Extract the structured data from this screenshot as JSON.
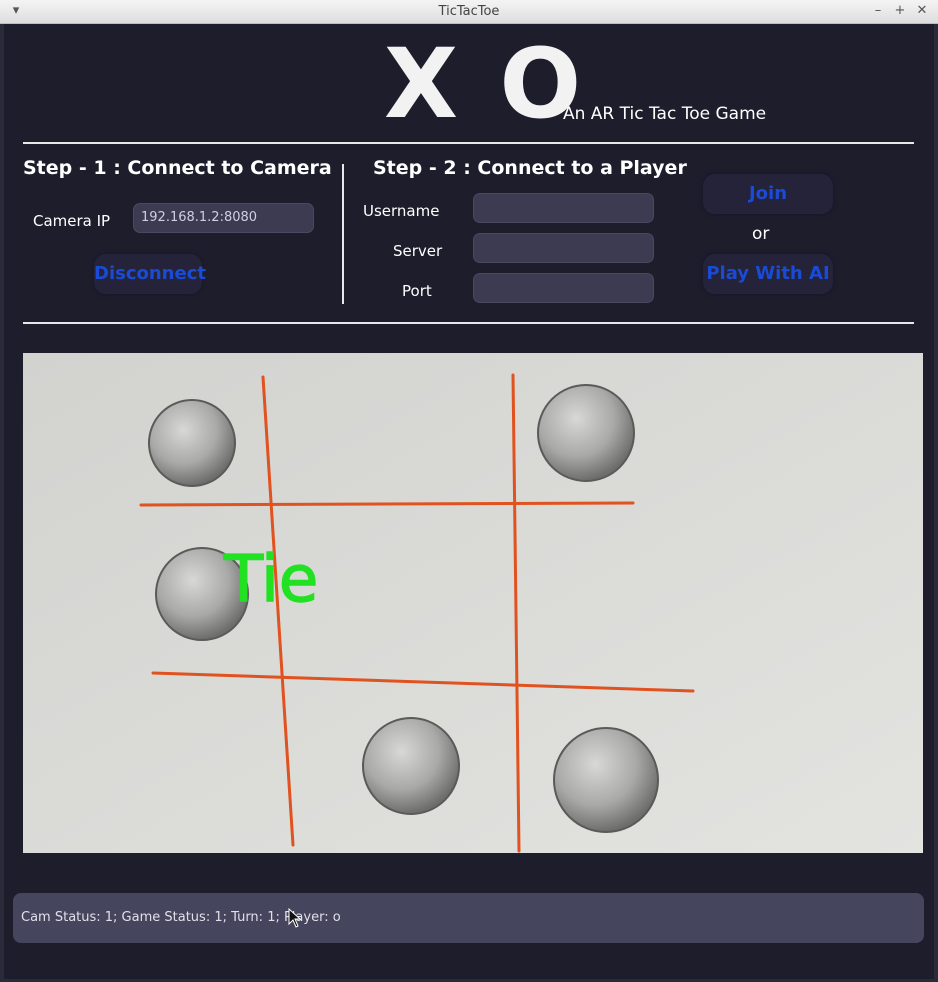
{
  "window": {
    "title": "TicTacToe"
  },
  "header": {
    "logo": "X O",
    "subtitle": "An AR Tic Tac Toe Game"
  },
  "step1": {
    "title": "Step - 1 : Connect to Camera",
    "camera_ip_label": "Camera IP",
    "camera_ip_value": "192.168.1.2:8080",
    "disconnect_label": "Disconnect"
  },
  "step2": {
    "title": "Step - 2 : Connect to a Player",
    "username_label": "Username",
    "server_label": "Server",
    "port_label": "Port",
    "username_value": "",
    "server_value": "",
    "port_value": "",
    "join_label": "Join",
    "or_label": "or",
    "play_ai_label": "Play With AI"
  },
  "camera_view": {
    "overlay_text": "Tie"
  },
  "status_bar": {
    "text": "Cam Status: 1;  Game Status: 1;  Turn: 1;  Player: o"
  },
  "colors": {
    "background": "#1e1d2b",
    "button_text": "#1a4bd6",
    "grid_line": "#e0521f",
    "overlay": "#22e022"
  }
}
